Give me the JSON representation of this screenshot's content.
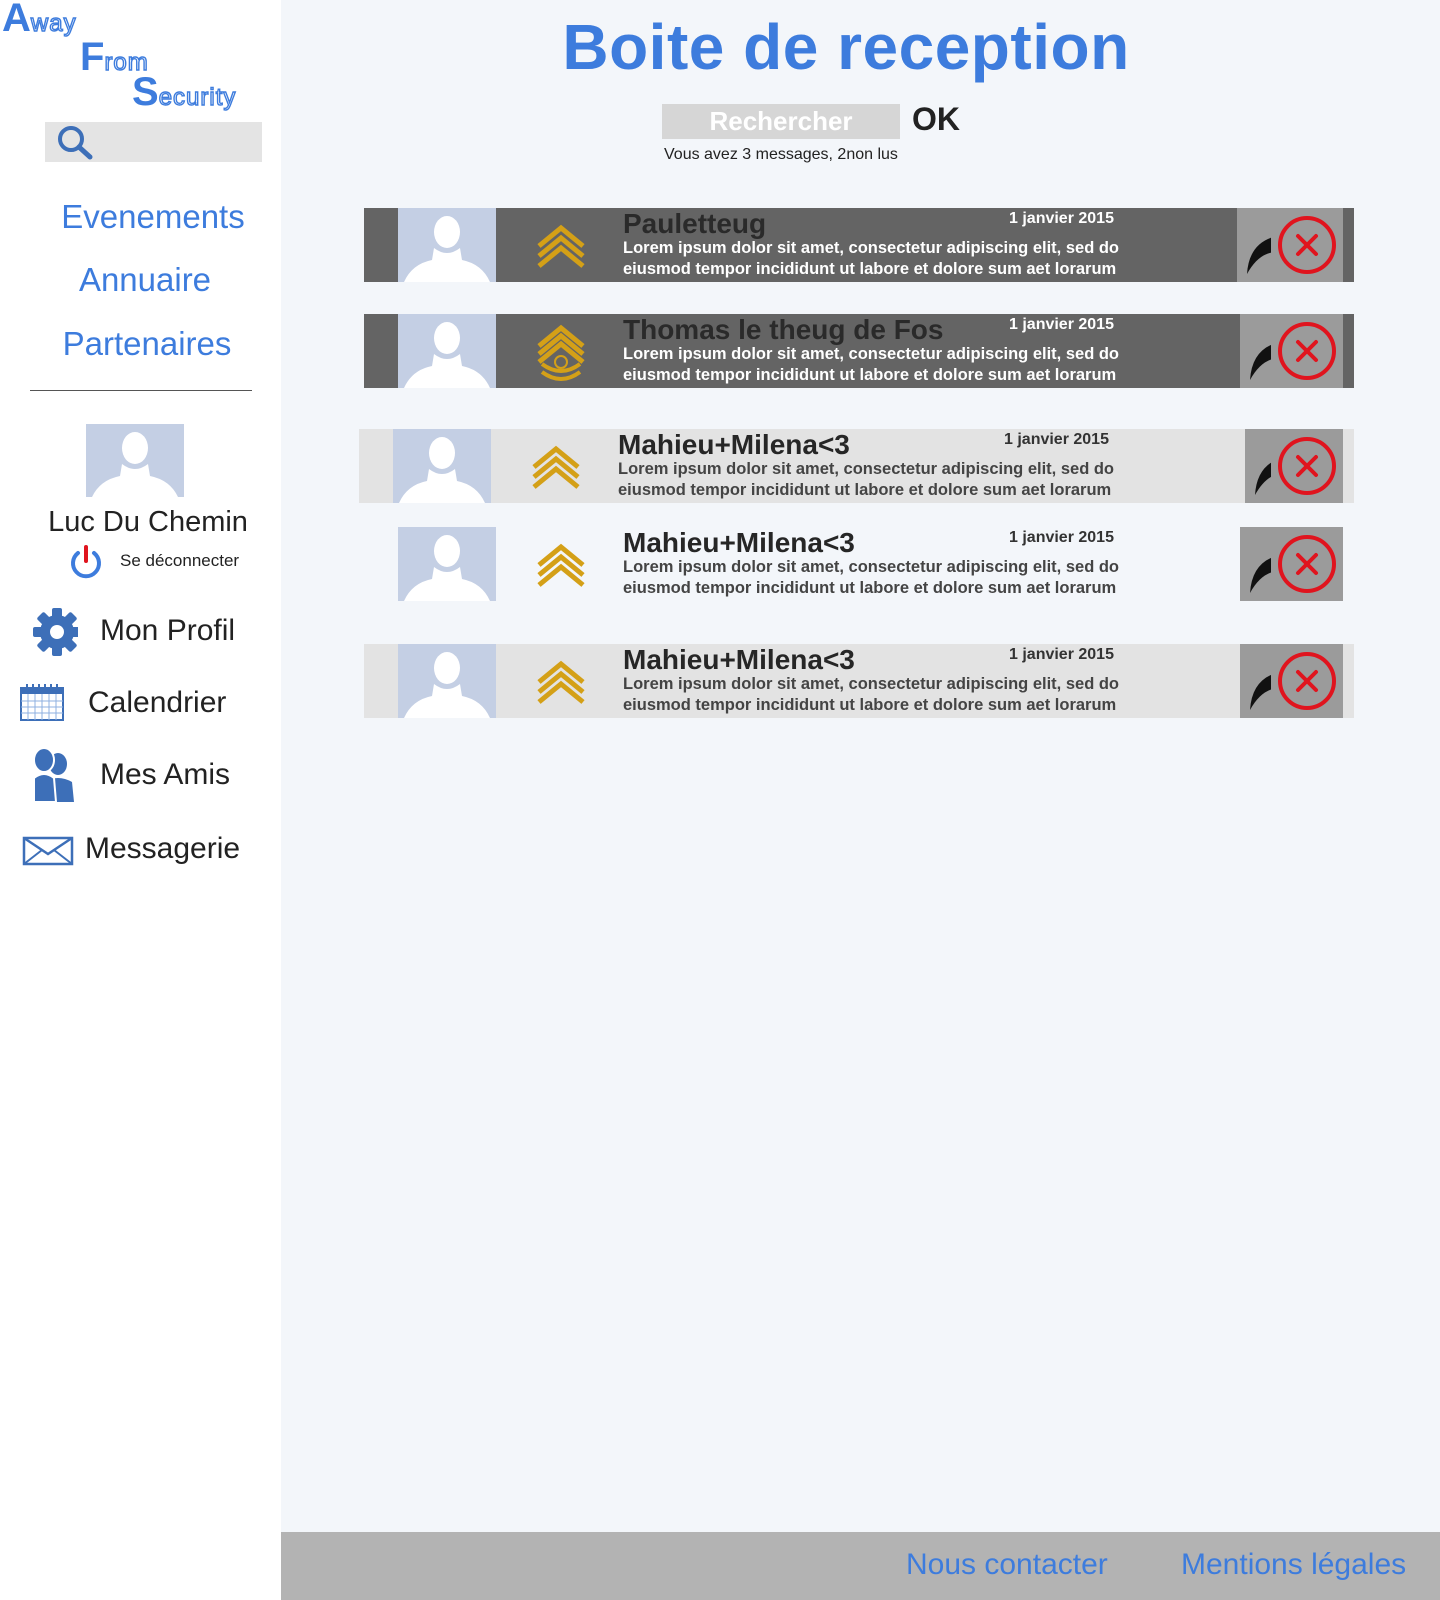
{
  "sidebar": {
    "logo": {
      "line1": {
        "cap": "A",
        "rest": "way"
      },
      "line2": {
        "cap": "F",
        "rest": "rom"
      },
      "line3": {
        "cap": "S",
        "rest": "ecurity"
      }
    },
    "search_icon": "search-icon",
    "nav": [
      {
        "label": "Evenements"
      },
      {
        "label": "Annuaire"
      },
      {
        "label": "Partenaires"
      }
    ],
    "user": {
      "name": "Luc Du Chemin",
      "logout_label": "Se déconnecter"
    },
    "menu": [
      {
        "label": "Mon Profil",
        "icon": "gear-icon"
      },
      {
        "label": "Calendrier",
        "icon": "calendar-icon"
      },
      {
        "label": "Mes Amis",
        "icon": "friends-icon"
      },
      {
        "label": "Messagerie",
        "icon": "envelope-icon"
      }
    ]
  },
  "main": {
    "title": "Boite de reception",
    "search": {
      "placeholder": "Rechercher",
      "ok_label": "OK"
    },
    "status": "Vous avez 3 messages, 2non lus",
    "messages": [
      {
        "sender": "Pauletteug",
        "date": "1 janvier 2015",
        "preview": "Lorem ipsum dolor sit amet, consectetur adipiscing elit, sed do eiusmod tempor incididunt ut labore et dolore sum aet lorarum",
        "unread": true,
        "rank_icon": "sergeant-chevron-icon"
      },
      {
        "sender": "Thomas le theug de Fos",
        "date": "1 janvier 2015",
        "preview": "Lorem ipsum dolor sit amet, consectetur adipiscing elit, sed do eiusmod tempor incididunt ut labore et dolore sum aet lorarum",
        "unread": true,
        "rank_icon": "sergeant-major-icon"
      },
      {
        "sender": "Mahieu+Milena<3",
        "date": "1 janvier 2015",
        "preview": "Lorem ipsum dolor sit amet, consectetur adipiscing elit, sed do eiusmod tempor incididunt ut labore et dolore sum aet lorarum",
        "unread": false,
        "rank_icon": "sergeant-chevron-icon"
      },
      {
        "sender": "Mahieu+Milena<3",
        "date": "1 janvier 2015",
        "preview": "Lorem ipsum dolor sit amet, consectetur adipiscing elit, sed do eiusmod tempor incididunt ut labore et dolore sum aet lorarum",
        "unread": false,
        "rank_icon": "sergeant-chevron-icon"
      },
      {
        "sender": "Mahieu+Milena<3",
        "date": "1 janvier 2015",
        "preview": "Lorem ipsum dolor sit amet, consectetur adipiscing elit, sed do eiusmod tempor incididunt ut labore et dolore sum aet lorarum",
        "unread": false,
        "rank_icon": "sergeant-chevron-icon"
      }
    ]
  },
  "footer": {
    "contact": "Nous contacter",
    "legal": "Mentions légales"
  },
  "colors": {
    "accent": "#3d7cdd",
    "unread_row": "#646464",
    "read_row": "#e3e3e3",
    "action_button": "#9b9b9b",
    "delete_red": "#e0141e",
    "rank_gold": "#d4a017",
    "footer": "#b3b3b3"
  }
}
